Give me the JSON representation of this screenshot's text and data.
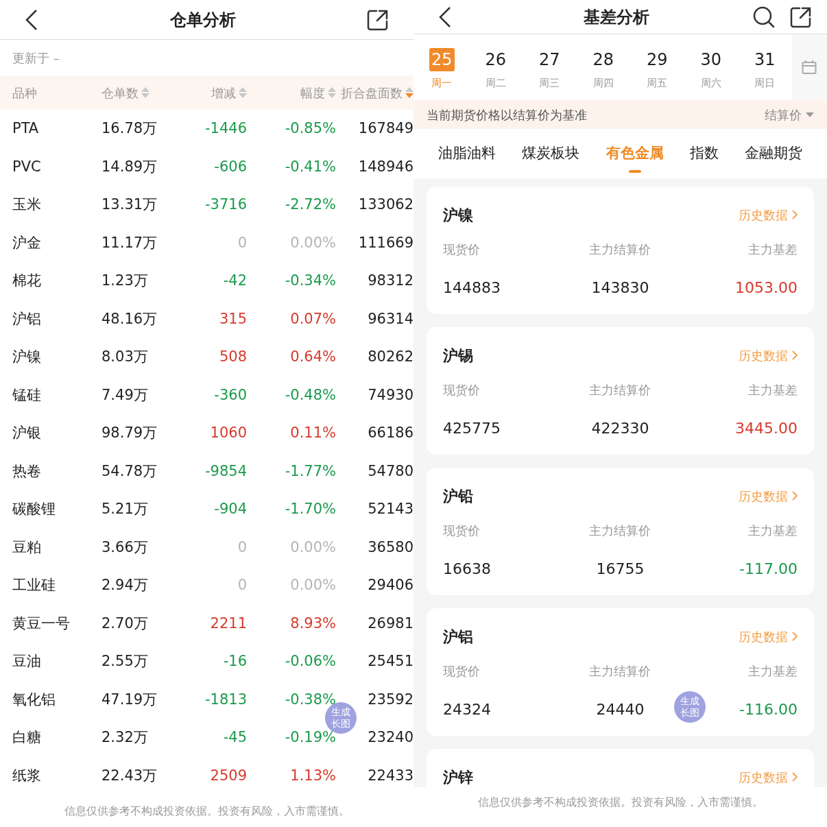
{
  "left": {
    "title": "仓单分析",
    "updated": "更新于 –",
    "columns": [
      {
        "label": "品种",
        "sortable": false
      },
      {
        "label": "仓单数",
        "sortable": true,
        "selected": false
      },
      {
        "label": "增减",
        "sortable": true,
        "selected": false
      },
      {
        "label": "幅度",
        "sortable": true,
        "selected": false
      },
      {
        "label": "折合盘面数",
        "sortable": true,
        "selected": true
      }
    ],
    "rows": [
      {
        "name": "PTA",
        "receipts": "16.78万",
        "change": "-1446",
        "pct": "-0.85%",
        "equiv": "167849",
        "color": "#1b9a4b"
      },
      {
        "name": "PVC",
        "receipts": "14.89万",
        "change": "-606",
        "pct": "-0.41%",
        "equiv": "148946",
        "color": "#1b9a4b"
      },
      {
        "name": "玉米",
        "receipts": "13.31万",
        "change": "-3716",
        "pct": "-2.72%",
        "equiv": "133062",
        "color": "#1b9a4b"
      },
      {
        "name": "沪金",
        "receipts": "11.17万",
        "change": "0",
        "pct": "0.00%",
        "equiv": "111669",
        "color": "#b5b5b5"
      },
      {
        "name": "棉花",
        "receipts": "1.23万",
        "change": "-42",
        "pct": "-0.34%",
        "equiv": "98312",
        "color": "#1b9a4b"
      },
      {
        "name": "沪铝",
        "receipts": "48.16万",
        "change": "315",
        "pct": "0.07%",
        "equiv": "96314",
        "color": "#d63a2c"
      },
      {
        "name": "沪镍",
        "receipts": "8.03万",
        "change": "508",
        "pct": "0.64%",
        "equiv": "80262",
        "color": "#d63a2c"
      },
      {
        "name": "锰硅",
        "receipts": "7.49万",
        "change": "-360",
        "pct": "-0.48%",
        "equiv": "74930",
        "color": "#1b9a4b"
      },
      {
        "name": "沪银",
        "receipts": "98.79万",
        "change": "1060",
        "pct": "0.11%",
        "equiv": "66186",
        "color": "#d63a2c"
      },
      {
        "name": "热卷",
        "receipts": "54.78万",
        "change": "-9854",
        "pct": "-1.77%",
        "equiv": "54780",
        "color": "#1b9a4b"
      },
      {
        "name": "碳酸锂",
        "receipts": "5.21万",
        "change": "-904",
        "pct": "-1.70%",
        "equiv": "52143",
        "color": "#1b9a4b"
      },
      {
        "name": "豆粕",
        "receipts": "3.66万",
        "change": "0",
        "pct": "0.00%",
        "equiv": "36580",
        "color": "#b5b5b5"
      },
      {
        "name": "工业硅",
        "receipts": "2.94万",
        "change": "0",
        "pct": "0.00%",
        "equiv": "29406",
        "color": "#b5b5b5"
      },
      {
        "name": "黄豆一号",
        "receipts": "2.70万",
        "change": "2211",
        "pct": "8.93%",
        "equiv": "26981",
        "color": "#d63a2c"
      },
      {
        "name": "豆油",
        "receipts": "2.55万",
        "change": "-16",
        "pct": "-0.06%",
        "equiv": "25451",
        "color": "#1b9a4b"
      },
      {
        "name": "氧化铝",
        "receipts": "47.19万",
        "change": "-1813",
        "pct": "-0.38%",
        "equiv": "23592",
        "color": "#1b9a4b"
      },
      {
        "name": "白糖",
        "receipts": "2.32万",
        "change": "-45",
        "pct": "-0.19%",
        "equiv": "23240",
        "color": "#1b9a4b"
      },
      {
        "name": "纸浆",
        "receipts": "22.43万",
        "change": "2509",
        "pct": "1.13%",
        "equiv": "22433",
        "color": "#d63a2c"
      }
    ],
    "disclaimer": "信息仅供参考不构成投资依据。投资有风险，入市需谨慎。",
    "float_button": [
      "生成",
      "长图"
    ]
  },
  "right": {
    "title": "基差分析",
    "dates": [
      {
        "day": "25",
        "weekday": "周一",
        "selected": true
      },
      {
        "day": "26",
        "weekday": "周二",
        "selected": false
      },
      {
        "day": "27",
        "weekday": "周三",
        "selected": false
      },
      {
        "day": "28",
        "weekday": "周四",
        "selected": false
      },
      {
        "day": "29",
        "weekday": "周五",
        "selected": false
      },
      {
        "day": "30",
        "weekday": "周六",
        "selected": false
      },
      {
        "day": "31",
        "weekday": "周日",
        "selected": false
      }
    ],
    "banner": {
      "text": "当前期货价格以结算价为基准",
      "dropdown": "结算价"
    },
    "tabs": [
      {
        "label": "油脂油料",
        "selected": false
      },
      {
        "label": "煤炭板块",
        "selected": false
      },
      {
        "label": "有色金属",
        "selected": true
      },
      {
        "label": "指数",
        "selected": false
      },
      {
        "label": "金融期货",
        "selected": false
      }
    ],
    "cards": [
      {
        "name": "沪镍",
        "link": "历史数据",
        "labels": [
          "现货价",
          "主力结算价",
          "主力基差"
        ],
        "spot": "144883",
        "settle": "143830",
        "basis": "1053.00",
        "color": "#d63a2c"
      },
      {
        "name": "沪锡",
        "link": "历史数据",
        "labels": [
          "现货价",
          "主力结算价",
          "主力基差"
        ],
        "spot": "425775",
        "settle": "422330",
        "basis": "3445.00",
        "color": "#d63a2c"
      },
      {
        "name": "沪铅",
        "link": "历史数据",
        "labels": [
          "现货价",
          "主力结算价",
          "主力基差"
        ],
        "spot": "16638",
        "settle": "16755",
        "basis": "-117.00",
        "color": "#1b9a4b"
      },
      {
        "name": "沪铝",
        "link": "历史数据",
        "labels": [
          "现货价",
          "主力结算价",
          "主力基差"
        ],
        "spot": "24324",
        "settle": "24440",
        "basis": "-116.00",
        "color": "#1b9a4b"
      },
      {
        "name": "沪锌",
        "link": "历史数据"
      }
    ],
    "disclaimer": "信息仅供参考不构成投资依据。投资有风险，入市需谨慎。",
    "float_button": [
      "生成",
      "长图"
    ]
  }
}
